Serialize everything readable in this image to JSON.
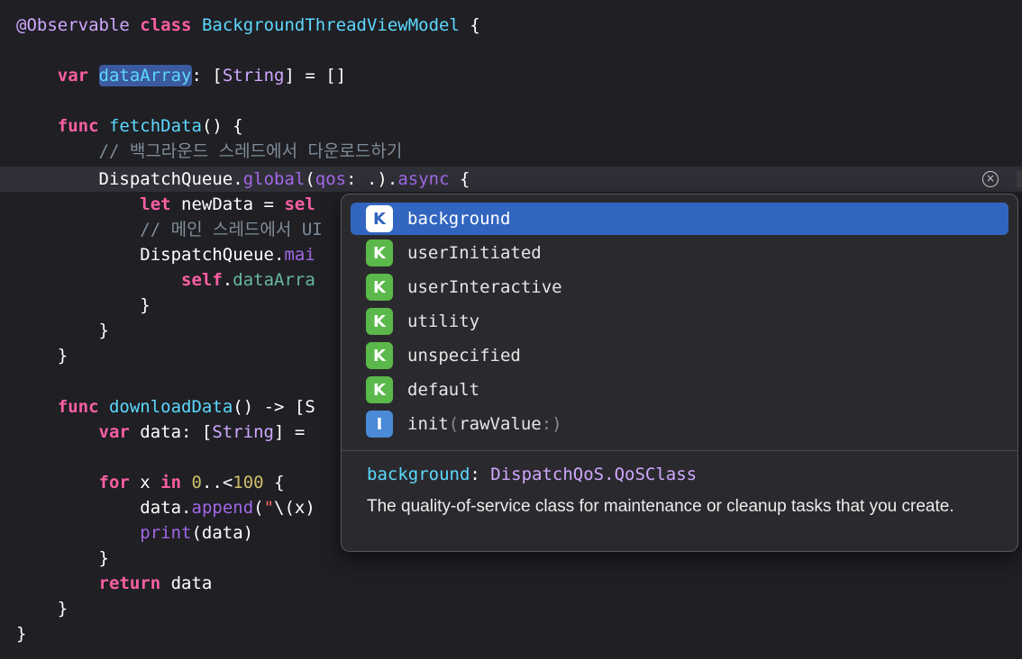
{
  "editor": {
    "class_decl": {
      "attr": "@Observable",
      "kw": "class",
      "name": "BackgroundThreadViewModel",
      "tail": " {"
    },
    "var_decl": {
      "kw": "var",
      "name": "dataArray",
      "colon": ":",
      "type_open": " [",
      "type": "String",
      "type_close": "] = []"
    },
    "fetch_decl": {
      "kw": "func",
      "name": "fetchData",
      "tail": "() {"
    },
    "comment1": "// 백그라운드 스레드에서 다운로드하기",
    "dispatch_line": {
      "obj": "DispatchQueue",
      "dot1": ".",
      "m1": "global",
      "p1": "(",
      "arg": "qos",
      "mid": ": .).",
      "m2": "async",
      "tail": " {"
    },
    "let_line": {
      "kw": "let",
      "rest": " newData = ",
      "kw2": "sel"
    },
    "comment2": "// 메인 스레드에서 UI",
    "main_line": {
      "obj": "DispatchQueue",
      "dot": ".",
      "mem": "mai"
    },
    "self_line": {
      "kw": "self",
      "dot": ".",
      "mem": "dataArra"
    },
    "close_brace": "}",
    "download_decl": {
      "kw": "func",
      "name": "downloadData",
      "tail": "() -> [S"
    },
    "var_data": {
      "kw": "var",
      "rest": " data: [",
      "type": "String",
      "tail": "] ="
    },
    "for_line": {
      "kw": "for",
      "var": " x ",
      "kw2": "in",
      "num1": "0",
      "op": "..<",
      "num2": "100",
      "tail": " {"
    },
    "append_line": {
      "obj": "data",
      "dot": ".",
      "mem": "append",
      "p": "(",
      "str": "\"",
      "interp": "\\(x)"
    },
    "print_line": {
      "fn": "print",
      "rest": "(data)"
    },
    "return_line": {
      "kw": "return",
      "rest": " data"
    }
  },
  "icons": {
    "clear": "clear-circle-icon",
    "clear_glyph": "×",
    "keyword": "K",
    "initializer": "I"
  },
  "autocomplete": {
    "items": [
      {
        "badge": "K",
        "label": "background",
        "selected": true
      },
      {
        "badge": "K",
        "label": "userInitiated"
      },
      {
        "badge": "K",
        "label": "userInteractive"
      },
      {
        "badge": "K",
        "label": "utility"
      },
      {
        "badge": "K",
        "label": "unspecified"
      },
      {
        "badge": "K",
        "label": "default"
      },
      {
        "badge": "I",
        "label_main": "init",
        "label_open": "(",
        "label_param": "rawValue",
        "label_close": ":)"
      }
    ],
    "doc": {
      "name": "background",
      "colon": ":",
      "type": "DispatchQoS.QoSClass",
      "description": "The quality-of-service class for maintenance or cleanup tasks that you create."
    }
  },
  "colors": {
    "background": "#1f1f24",
    "keyword": "#fc5fa3",
    "type": "#5dd8ff",
    "selection": "#3265c0"
  }
}
